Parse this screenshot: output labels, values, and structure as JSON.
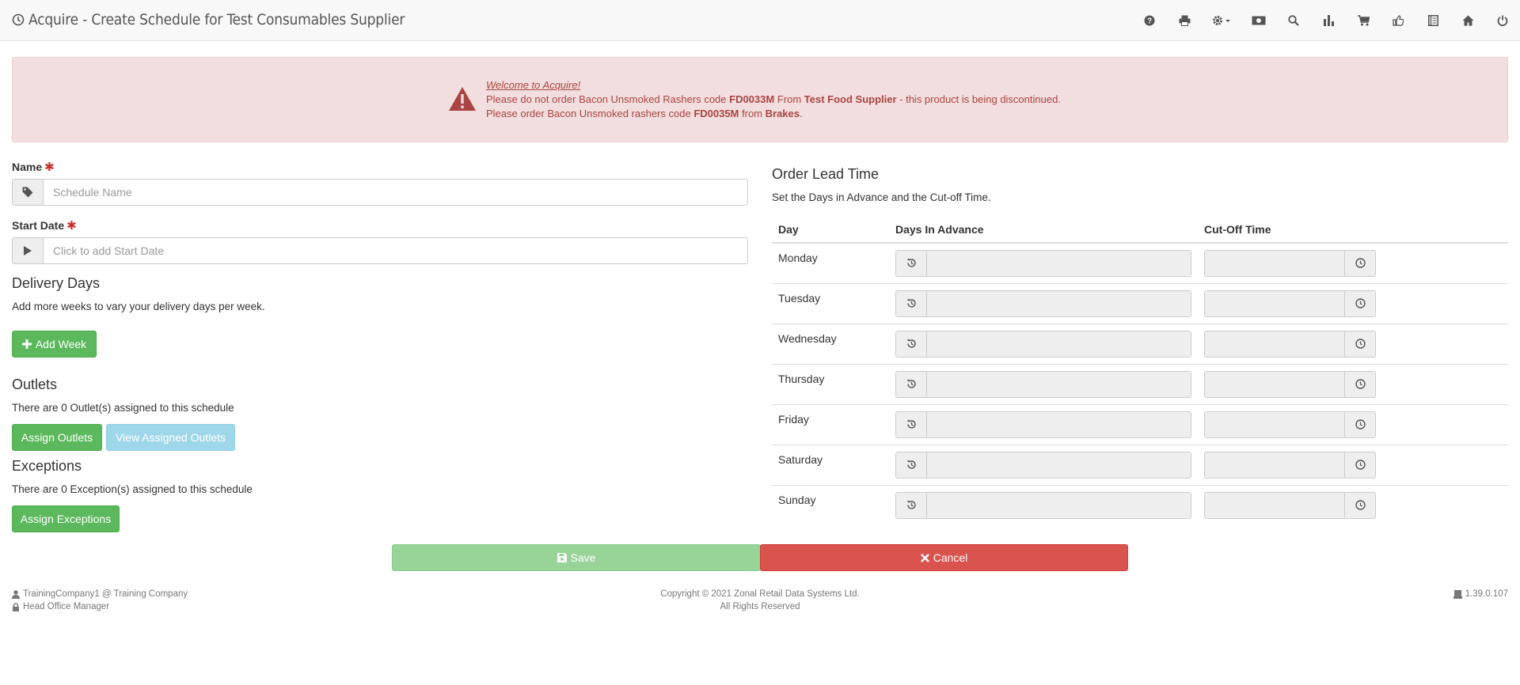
{
  "header": {
    "title": "Acquire - Create Schedule for Test Consumables Supplier",
    "icons": [
      "help-icon",
      "print-icon",
      "settings-icon",
      "money-icon",
      "search-icon",
      "chart-icon",
      "cart-icon",
      "thumbs-up-icon",
      "book-icon",
      "home-icon",
      "power-icon"
    ]
  },
  "alert": {
    "title": "Welcome to Acquire!",
    "line1_a": "Please do not order Bacon Unsmoked Rashers code ",
    "line1_code": "FD0033M",
    "line1_b": " From ",
    "line1_supplier": "Test Food Supplier",
    "line1_c": " - this product is being discontinued.",
    "line2_a": "Please order Bacon Unsmoked rashers code ",
    "line2_code": "FD0035M",
    "line2_b": " from ",
    "line2_supplier": "Brakes",
    "line2_c": "."
  },
  "form": {
    "name_label": "Name",
    "name_placeholder": "Schedule Name",
    "start_label": "Start Date",
    "start_placeholder": "Click to add Start Date",
    "required_mark": "✱"
  },
  "delivery": {
    "heading": "Delivery Days",
    "text": "Add more weeks to vary your delivery days per week.",
    "add_week": "Add Week"
  },
  "outlets": {
    "heading": "Outlets",
    "text": "There are 0 Outlet(s) assigned to this schedule",
    "assign": "Assign Outlets",
    "view": "View Assigned Outlets"
  },
  "exceptions": {
    "heading": "Exceptions",
    "text": "There are 0 Exception(s) assigned to this schedule",
    "assign": "Assign Exceptions"
  },
  "lead": {
    "heading": "Order Lead Time",
    "text": "Set the Days in Advance and the Cut-off Time.",
    "columns": [
      "Day",
      "Days In Advance",
      "Cut-Off Time"
    ],
    "days": [
      "Monday",
      "Tuesday",
      "Wednesday",
      "Thursday",
      "Friday",
      "Saturday",
      "Sunday"
    ]
  },
  "actions": {
    "save": "Save",
    "cancel": "Cancel"
  },
  "footer": {
    "user": "TrainingCompany1 @ Training Company",
    "role": "Head Office Manager",
    "copyright": "Copyright © 2021 Zonal Retail Data Systems Ltd.",
    "rights": "All Rights Reserved",
    "version": "1.39.0.107"
  },
  "colors": {
    "success": "#5cb85c",
    "danger": "#d9534f",
    "alert_bg": "#f2dede",
    "alert_text": "#a94442"
  }
}
